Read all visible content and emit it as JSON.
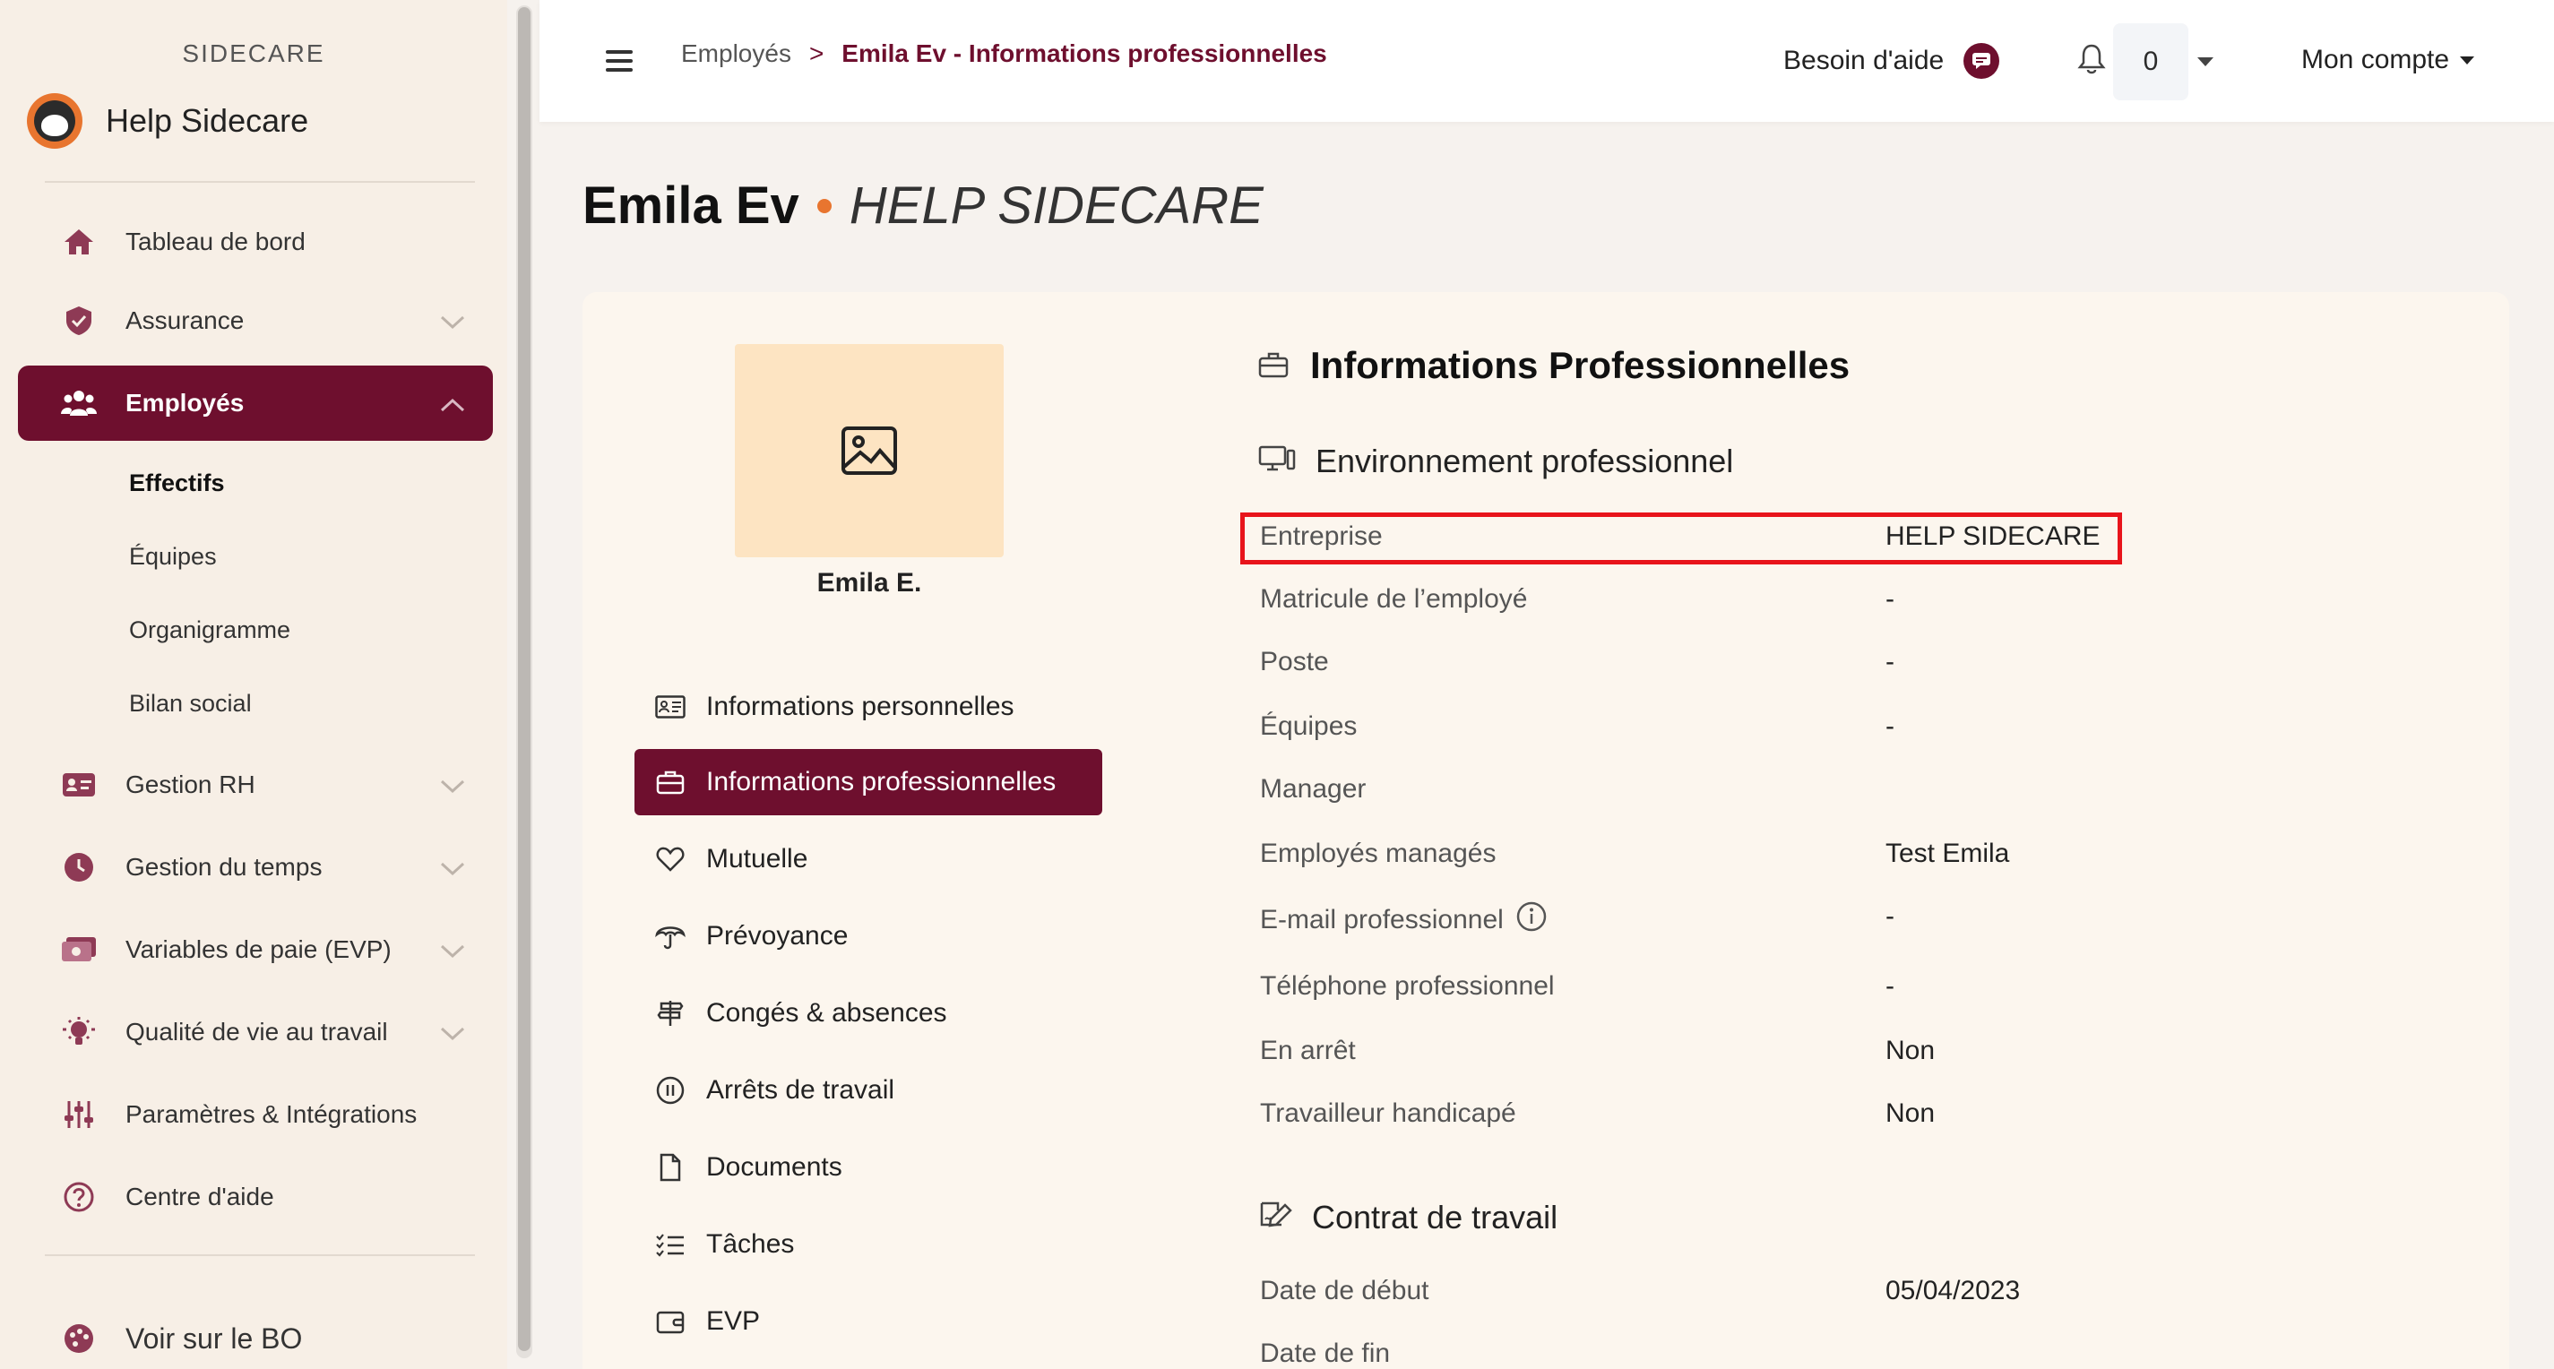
{
  "sidebar": {
    "brand_top": "SIDECARE",
    "brand_name": "Help Sidecare",
    "items": [
      {
        "label": "Tableau de bord"
      },
      {
        "label": "Assurance"
      },
      {
        "label": "Employés"
      },
      {
        "label": "Gestion RH"
      },
      {
        "label": "Gestion du temps"
      },
      {
        "label": "Variables de paie (EVP)"
      },
      {
        "label": "Qualité de vie au travail"
      },
      {
        "label": "Paramètres & Intégrations"
      },
      {
        "label": "Centre d'aide"
      },
      {
        "label": "Voir sur le BO"
      }
    ],
    "sub_items": [
      {
        "label": "Effectifs"
      },
      {
        "label": "Équipes"
      },
      {
        "label": "Organigramme"
      },
      {
        "label": "Bilan social"
      }
    ]
  },
  "topbar": {
    "breadcrumb_1": "Employés",
    "breadcrumb_sep": ">",
    "breadcrumb_2": "Emila Ev - Informations professionnelles",
    "help_label": "Besoin d'aide",
    "notif_count": "0",
    "account_label": "Mon compte"
  },
  "header": {
    "name": "Emila Ev",
    "company": "HELP SIDECARE"
  },
  "profile": {
    "short_name": "Emila E."
  },
  "menu": [
    {
      "label": "Informations personnelles"
    },
    {
      "label": "Informations professionnelles"
    },
    {
      "label": "Mutuelle"
    },
    {
      "label": "Prévoyance"
    },
    {
      "label": "Congés & absences"
    },
    {
      "label": "Arrêts de travail"
    },
    {
      "label": "Documents"
    },
    {
      "label": "Tâches"
    },
    {
      "label": "EVP"
    }
  ],
  "section": {
    "title": "Informations Professionnelles",
    "env_title": "Environnement professionnel",
    "contract_title": "Contrat de travail",
    "rows": [
      {
        "label": "Entreprise",
        "value": "HELP SIDECARE"
      },
      {
        "label": "Matricule de l’employé",
        "value": "-"
      },
      {
        "label": "Poste",
        "value": "-"
      },
      {
        "label": "Équipes",
        "value": "-"
      },
      {
        "label": "Manager",
        "value": ""
      },
      {
        "label": "Employés managés",
        "value": "Test Emila"
      },
      {
        "label": "E-mail professionnel",
        "value": "-"
      },
      {
        "label": "Téléphone professionnel",
        "value": "-"
      },
      {
        "label": "En arrêt",
        "value": "Non"
      },
      {
        "label": "Travailleur handicapé",
        "value": "Non"
      }
    ],
    "contract_rows": [
      {
        "label": "Date de début",
        "value": "05/04/2023"
      },
      {
        "label": "Date de fin",
        "value": ""
      }
    ]
  },
  "colors": {
    "accent": "#6e0f2e",
    "orange": "#e8752f",
    "highlight": "#e8141b"
  }
}
